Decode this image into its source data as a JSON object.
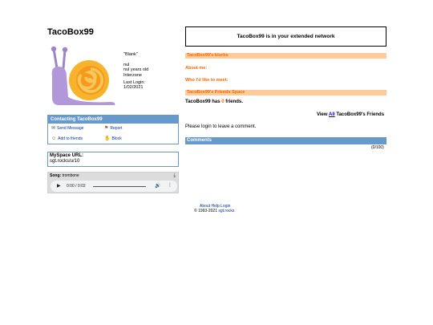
{
  "profile": {
    "username": "TacoBox99",
    "headline": "\"Blank\"",
    "info_line1": "nul",
    "info_line2": "nul years old",
    "info_line3": "Interzone",
    "last_login_label": "Last Login:",
    "last_login_date": "1/02/2021"
  },
  "contact": {
    "header": "Contacting TacoBox99",
    "send_message": "Send Message",
    "report": "Report",
    "add_friends": "Add to friends",
    "block": "Block"
  },
  "url_box": {
    "title": "MySpace URL:",
    "value": "sgt.rocks/u/10"
  },
  "song": {
    "label": "Song:",
    "name": "trombone",
    "time": "0:00 / 0:02",
    "progress": 0
  },
  "main": {
    "network_text": "TacoBox99 is in your extended network",
    "blurbs": "TacoBox99's blurbs",
    "about_me": "About me:",
    "like_to_meet": "Who I'd like to meet:",
    "friends_space": "TacoBox99's Friends Space",
    "friends_prefix": "TacoBox99 has",
    "friends_num": "0",
    "friends_suffix": "friends.",
    "view_prefix": "View",
    "view_all": "All",
    "view_suffix": "TacoBox99's Friends",
    "login_comment": "Please login to leave a comment.",
    "comments_header": "Comments",
    "comment_count": "(0/100)"
  },
  "footer": {
    "about": "About",
    "help": "Help",
    "login": "Login",
    "copyright": "© 1993-2021",
    "site": "sgt.rocks"
  },
  "colors": {
    "accent_blue": "#6699cc",
    "accent_orange": "#ff6600",
    "orange_bar": "#ffcc99"
  }
}
